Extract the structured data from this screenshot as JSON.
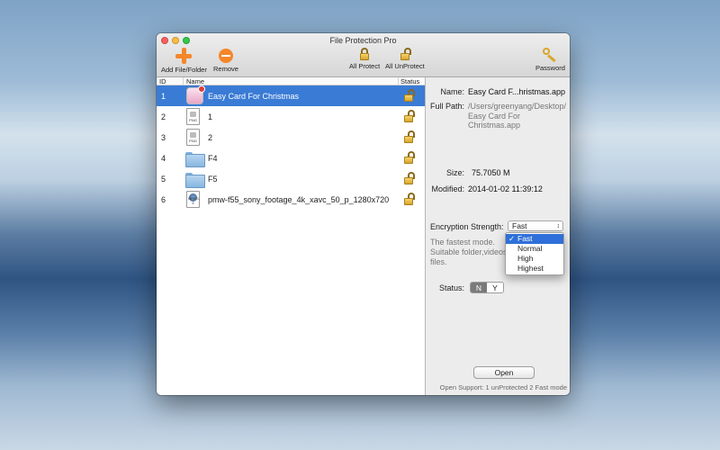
{
  "window": {
    "title": "File Protection Pro"
  },
  "toolbar": {
    "add_label": "Add File/Folder",
    "remove_label": "Remove",
    "all_protect_label": "All Protect",
    "all_unprotect_label": "All UnProtect",
    "password_label": "Password"
  },
  "table": {
    "columns": {
      "id": "ID",
      "name": "Name",
      "status": "Status"
    },
    "rows": [
      {
        "id": "1",
        "name": "Easy Card For Christmas",
        "icon": "app-icon",
        "status": "unlocked-icon"
      },
      {
        "id": "2",
        "name": "1",
        "icon": "png-file-icon",
        "status": "unlocked-icon"
      },
      {
        "id": "3",
        "name": "2",
        "icon": "png-file-icon",
        "status": "unlocked-icon"
      },
      {
        "id": "4",
        "name": "F4",
        "icon": "folder-icon",
        "status": "unlocked-icon"
      },
      {
        "id": "5",
        "name": "F5",
        "icon": "folder-icon",
        "status": "unlocked-icon"
      },
      {
        "id": "6",
        "name": "pmw-f55_sony_footage_4k_xavc_50_p_1280x720",
        "icon": "video-file-icon",
        "status": "unlocked-icon"
      }
    ],
    "file_tags": {
      "png": "PNG",
      "video": "MPEG-4"
    }
  },
  "details": {
    "name_label": "Name:",
    "name_value": "Easy Card F...hristmas.app",
    "path_label": "Full Path:",
    "path_line1": "/Users/greenyang/Desktop/",
    "path_line2": "Easy Card For Christmas.app",
    "size_label": "Size:",
    "size_value": "75.7050 M",
    "modified_label": "Modified:",
    "modified_value": "2014-01-02 11:39:12",
    "encryption_label": "Encryption Strength:",
    "encryption_selected": "Fast",
    "encryption_options": [
      "Fast",
      "Normal",
      "High",
      "Highest"
    ],
    "desc_line1": "The fastest mode.",
    "desc_line2": "Suitable folder,videos a",
    "desc_line3": "files.",
    "status_label": "Status:",
    "status_n": "N",
    "status_y": "Y",
    "open_button": "Open",
    "footer": "Open Support: 1 unProtected 2 Fast mode"
  },
  "colors": {
    "accent": "#3a7bd5",
    "orange": "#f5862a"
  }
}
